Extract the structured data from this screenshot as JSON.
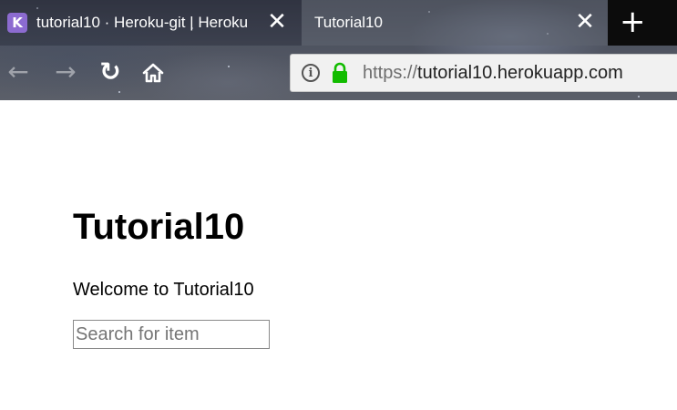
{
  "browser": {
    "tabs": [
      {
        "title": "tutorial10 · Heroku-git | Heroku",
        "favicon": "heroku-icon",
        "favicon_glyph": "K",
        "active": false
      },
      {
        "title": "Tutorial10",
        "active": true
      }
    ],
    "close_glyph": "✕",
    "new_tab_glyph": "+",
    "nav": {
      "back_glyph": "←",
      "forward_glyph": "→",
      "reload_glyph": "↻"
    },
    "url": {
      "scheme": "https://",
      "host": "tutorial10.herokuapp.com",
      "info_glyph": "i",
      "secure": true
    }
  },
  "page": {
    "heading": "Tutorial10",
    "welcome": "Welcome to Tutorial10",
    "search": {
      "placeholder": "Search for item",
      "value": ""
    }
  },
  "colors": {
    "lock": "#12bc00",
    "heroku_favicon": "#8c6bd0"
  }
}
